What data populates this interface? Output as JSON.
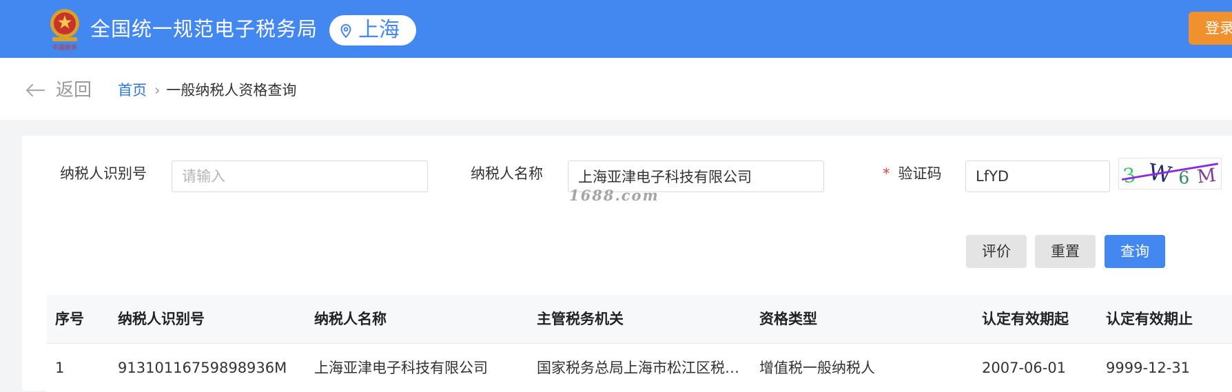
{
  "header": {
    "title": "全国统一规范电子税务局",
    "region": "上海",
    "login": "登录",
    "emblem_icon": "tax-emblem-icon",
    "colors": {
      "brand": "#4387f0",
      "login": "#f0912d"
    }
  },
  "nav": {
    "back": "返回",
    "home": "首页",
    "separator": "›",
    "current": "一般纳税人资格查询"
  },
  "form": {
    "taxpayer_id": {
      "label": "纳税人识别号",
      "value": "",
      "placeholder": "请输入"
    },
    "taxpayer_name": {
      "label": "纳税人名称",
      "value": "上海亚津电子科技有限公司"
    },
    "captcha": {
      "required_mark": "*",
      "label": "验证码",
      "value": "LfYD",
      "image_text": "3W6M"
    },
    "watermark": "1688.com"
  },
  "buttons": {
    "evaluate": "评价",
    "reset": "重置",
    "query": "查询"
  },
  "table": {
    "columns": [
      "序号",
      "纳税人识别号",
      "纳税人名称",
      "主管税务机关",
      "资格类型",
      "认定有效期起",
      "认定有效期止"
    ],
    "rows": [
      [
        "1",
        "9131011675989893​6M",
        "上海亚津电子科技有限公司",
        "国家税务总局上海市松江区税…",
        "增值税一般纳税人",
        "2007-06-01",
        "9999-12-31"
      ]
    ]
  }
}
